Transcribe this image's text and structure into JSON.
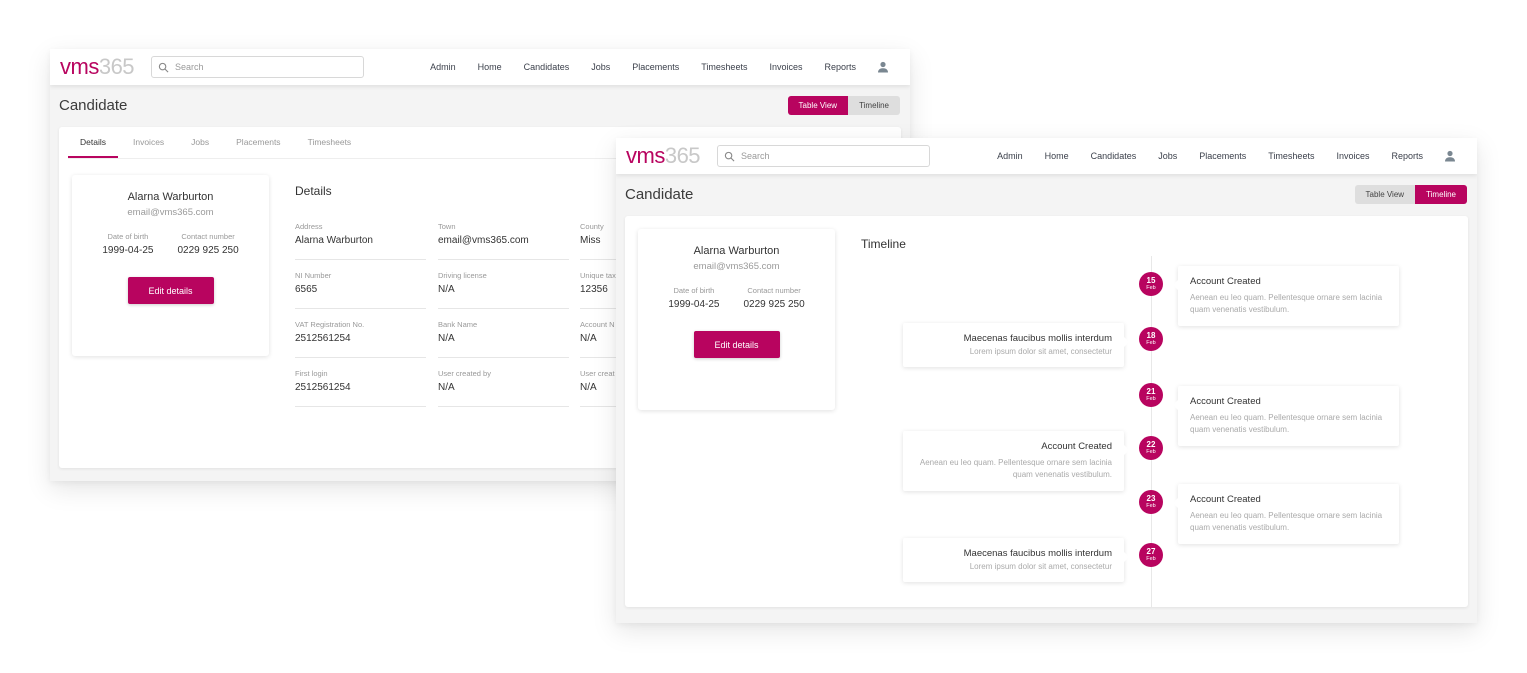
{
  "app": {
    "logo_brand": "vms",
    "logo_number": "365",
    "search_placeholder": "Search",
    "nav": [
      "Admin",
      "Home",
      "Candidates",
      "Jobs",
      "Placements",
      "Timesheets",
      "Invoices",
      "Reports"
    ],
    "user_icon": "person-icon",
    "accent_color": "#b8045f"
  },
  "table_view_window": {
    "page_title": "Candidate",
    "toggle": {
      "table_view": "Table View",
      "timeline": "Timeline",
      "active": "Table View"
    },
    "tabs": [
      "Details",
      "Invoices",
      "Jobs",
      "Placements",
      "Timesheets"
    ],
    "active_tab": "Details",
    "profile": {
      "name": "Alarna Warburton",
      "email": "email@vms365.com",
      "dob_label": "Date of birth",
      "dob": "1999-04-25",
      "contact_label": "Contact number",
      "contact": "0229 925 250",
      "edit_button": "Edit details"
    },
    "details_title": "Details",
    "fields": [
      {
        "label": "Address",
        "value": "Alarna Warburton"
      },
      {
        "label": "Town",
        "value": "email@vms365.com"
      },
      {
        "label": "County",
        "value": "Miss"
      },
      {
        "label": "NI Number",
        "value": "6565"
      },
      {
        "label": "Driving license",
        "value": "N/A"
      },
      {
        "label": "Unique tax",
        "value": "12356"
      },
      {
        "label": "VAT Registration No.",
        "value": "2512561254"
      },
      {
        "label": "Bank Name",
        "value": "N/A"
      },
      {
        "label": "Account N",
        "value": "N/A"
      },
      {
        "label": "First login",
        "value": "2512561254"
      },
      {
        "label": "User created by",
        "value": "N/A"
      },
      {
        "label": "User creat",
        "value": "N/A"
      }
    ]
  },
  "timeline_window": {
    "page_title": "Candidate",
    "toggle": {
      "table_view": "Table View",
      "timeline": "Timeline",
      "active": "Timeline"
    },
    "profile": {
      "name": "Alarna Warburton",
      "email": "email@vms365.com",
      "dob_label": "Date of birth",
      "dob": "1999-04-25",
      "contact_label": "Contact number",
      "contact": "0229 925 250",
      "edit_button": "Edit details"
    },
    "timeline_title": "Timeline",
    "events": [
      {
        "day": "15",
        "month": "Feb",
        "side": "right",
        "title": "Account Created",
        "body": "Aenean eu leo quam. Pellentesque ornare sem lacinia quam venenatis vestibulum."
      },
      {
        "day": "18",
        "month": "Feb",
        "side": "left",
        "title": "Maecenas faucibus mollis interdum",
        "body": "Lorem ipsum dolor sit amet, consectetur"
      },
      {
        "day": "21",
        "month": "Feb",
        "side": "right",
        "title": "Account Created",
        "body": "Aenean eu leo quam. Pellentesque ornare sem lacinia quam venenatis vestibulum."
      },
      {
        "day": "22",
        "month": "Feb",
        "side": "left",
        "title": "Account Created",
        "body": "Aenean eu leo quam. Pellentesque ornare sem lacinia quam venenatis vestibulum."
      },
      {
        "day": "23",
        "month": "Feb",
        "side": "right",
        "title": "Account Created",
        "body": "Aenean eu leo quam. Pellentesque ornare sem lacinia quam venenatis vestibulum."
      },
      {
        "day": "27",
        "month": "Feb",
        "side": "left",
        "title": "Maecenas faucibus mollis interdum",
        "body": "Lorem ipsum dolor sit amet, consectetur"
      }
    ]
  }
}
